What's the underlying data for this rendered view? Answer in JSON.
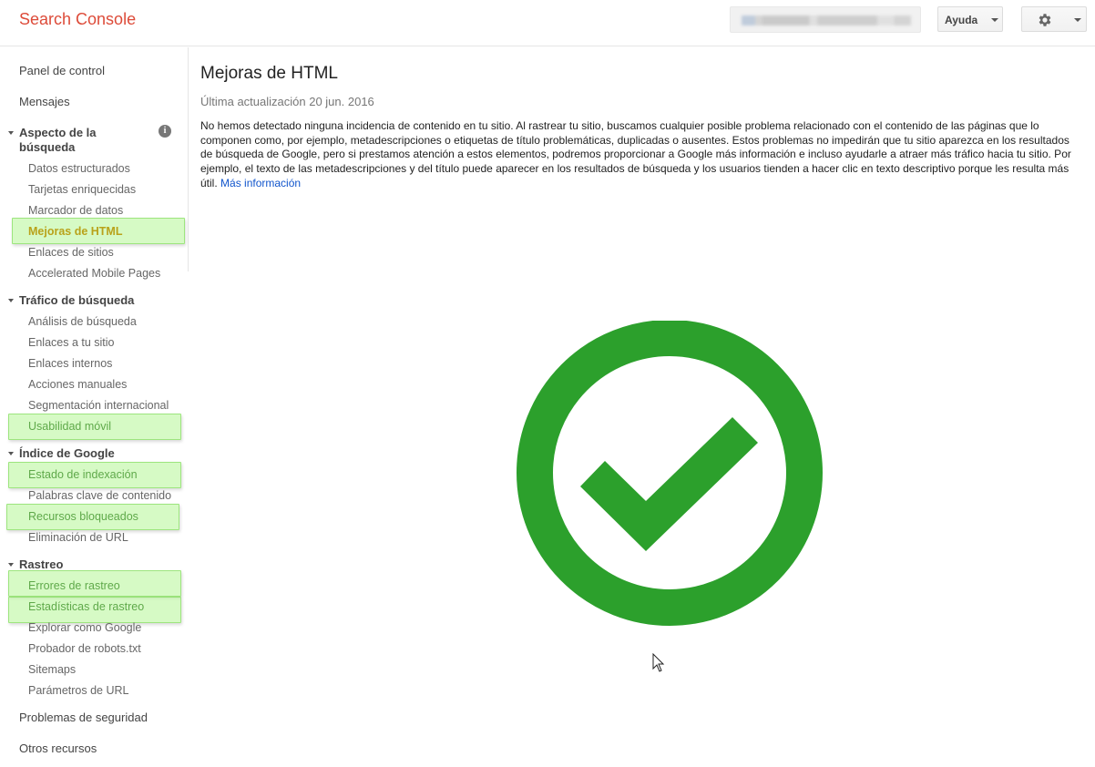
{
  "header": {
    "logo": "Search Console",
    "help_label": "Ayuda"
  },
  "sidebar": {
    "dashboard": "Panel de control",
    "messages": "Mensajes",
    "search_appearance": {
      "title": "Aspecto de la búsqueda",
      "info_icon": "i",
      "items": [
        "Datos estructurados",
        "Tarjetas enriquecidas",
        "Marcador de datos",
        "Mejoras de HTML",
        "Enlaces de sitios",
        "Accelerated Mobile Pages"
      ]
    },
    "search_traffic": {
      "title": "Tráfico de búsqueda",
      "items": [
        "Análisis de búsqueda",
        "Enlaces a tu sitio",
        "Enlaces internos",
        "Acciones manuales",
        "Segmentación internacional",
        "Usabilidad móvil"
      ]
    },
    "google_index": {
      "title": "Índice de Google",
      "items": [
        "Estado de indexación",
        "Palabras clave de contenido",
        "Recursos bloqueados",
        "Eliminación de URL"
      ]
    },
    "crawl": {
      "title": "Rastreo",
      "items": [
        "Errores de rastreo",
        "Estadísticas de rastreo",
        "Explorar como Google",
        "Probador de robots.txt",
        "Sitemaps",
        "Parámetros de URL"
      ]
    },
    "security_issues": "Problemas de seguridad",
    "other_resources": "Otros recursos"
  },
  "main": {
    "title": "Mejoras de HTML",
    "updated": "Última actualización 20 jun. 2016",
    "description": "No hemos detectado ninguna incidencia de contenido en tu sitio. Al rastrear tu sitio, buscamos cualquier posible problema relacionado con el contenido de las páginas que lo componen como, por ejemplo, metadescripciones o etiquetas de título problemáticas, duplicadas o ausentes. Estos problemas no impedirán que tu sitio aparezca en los resultados de búsqueda de Google, pero si prestamos atención a estos elementos, podremos proporcionar a Google más información e incluso ayudarle a atraer más tráfico hacia tu sitio. Por ejemplo, el texto de las metadescripciones y del título puede aparecer en los resultados de búsqueda y los usuarios tienden a hacer clic en texto descriptivo porque les resulta más útil.",
    "more_info": "Más información"
  },
  "colors": {
    "logo": "#dd4b39",
    "success_green": "#2ca02c",
    "highlight": "#b5f696",
    "link": "#1155cc"
  },
  "icons": [
    "gear-icon",
    "info-icon",
    "checkmark-circle-icon",
    "mouse-cursor-icon"
  ]
}
